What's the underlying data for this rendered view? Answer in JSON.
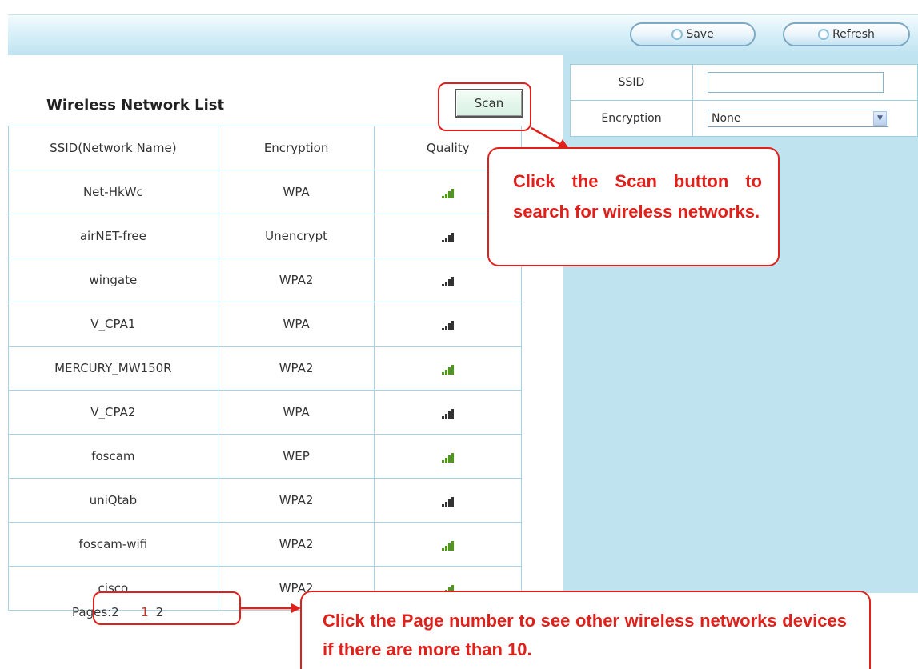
{
  "toolbar": {
    "save_label": "Save",
    "refresh_label": "Refresh"
  },
  "form": {
    "ssid_label": "SSID",
    "ssid_value": "",
    "encryption_label": "Encryption",
    "encryption_value": "None"
  },
  "list": {
    "title": "Wireless Network List",
    "scan_label": "Scan",
    "headers": [
      "SSID(Network Name)",
      "Encryption",
      "Quality"
    ],
    "rows": [
      {
        "ssid": "Net-HkWc",
        "encryption": "WPA",
        "quality_icon": "signal-green-icon"
      },
      {
        "ssid": "airNET-free",
        "encryption": "Unencrypt",
        "quality_icon": "signal-dark-icon"
      },
      {
        "ssid": "wingate",
        "encryption": "WPA2",
        "quality_icon": "signal-dark-icon"
      },
      {
        "ssid": "V_CPA1",
        "encryption": "WPA",
        "quality_icon": "signal-dark-icon"
      },
      {
        "ssid": "MERCURY_MW150R",
        "encryption": "WPA2",
        "quality_icon": "signal-green-icon"
      },
      {
        "ssid": "V_CPA2",
        "encryption": "WPA",
        "quality_icon": "signal-dark-icon"
      },
      {
        "ssid": "foscam",
        "encryption": "WEP",
        "quality_icon": "signal-green-icon"
      },
      {
        "ssid": "uniQtab",
        "encryption": "WPA2",
        "quality_icon": "signal-dark-icon"
      },
      {
        "ssid": "foscam-wifi",
        "encryption": "WPA2",
        "quality_icon": "signal-green-icon"
      },
      {
        "ssid": "cisco",
        "encryption": "WPA2",
        "quality_icon": "signal-green-icon"
      }
    ]
  },
  "pagination": {
    "label": "Pages:2",
    "pages": [
      "1",
      "2"
    ],
    "current": "1"
  },
  "annotations": {
    "scan_tip": "Click the Scan button to search for wireless networks.",
    "page_tip": "Click the Page number to see other wireless networks devices if there are more than 10."
  },
  "colors": {
    "annotation_red": "#e0201b",
    "panel_blue": "#bfe4f0",
    "signal_green": "#4c9a16"
  }
}
